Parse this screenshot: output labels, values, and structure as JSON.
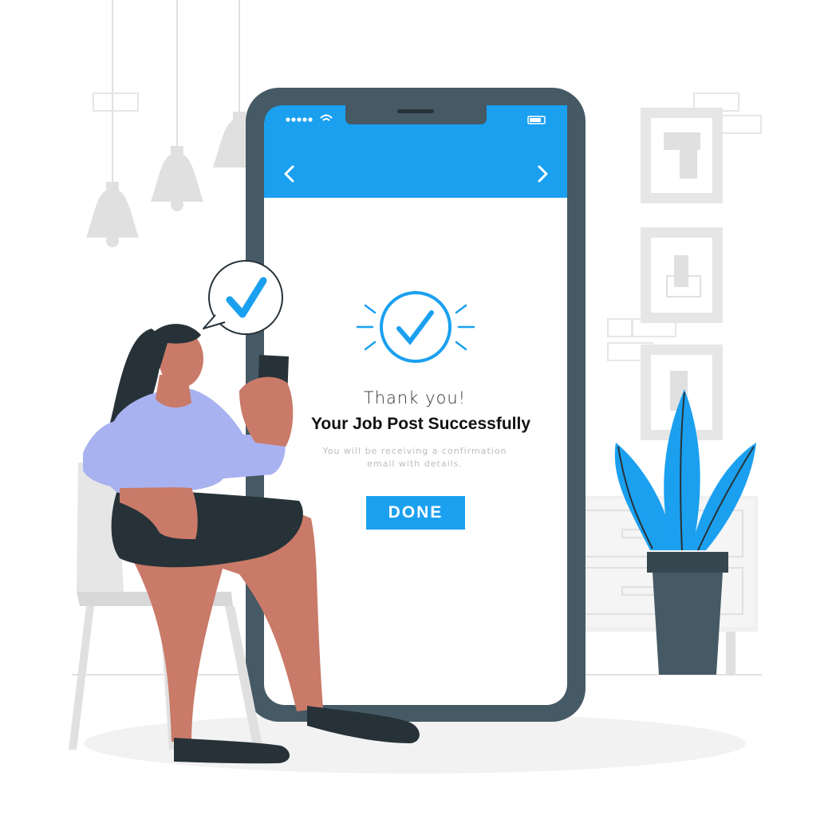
{
  "screen": {
    "thanks": "Thank you!",
    "headline": "Your Job Post Successfully",
    "subtext_line1": "You will be receiving a confirmation",
    "subtext_line2": "email with details.",
    "done_label": "DONE"
  },
  "colors": {
    "accent": "#1ba0f0",
    "phone_frame": "#455a64",
    "skin": "#c97a68",
    "shirt": "#a8b2f0",
    "skirt": "#263238"
  },
  "icons": [
    "back-icon",
    "forward-icon",
    "check-circle-icon",
    "check-bubble-icon",
    "wifi-icon",
    "battery-icon",
    "signal-dots-icon"
  ]
}
